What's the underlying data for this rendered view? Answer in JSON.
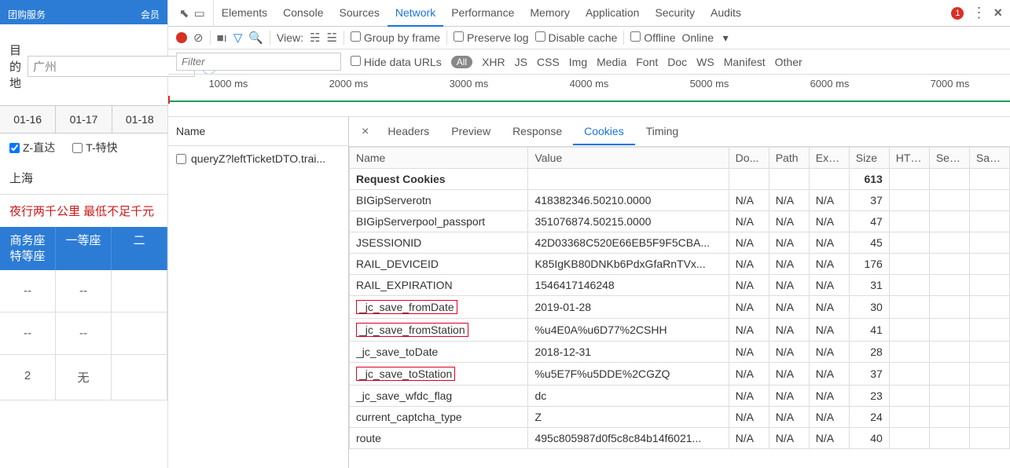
{
  "left": {
    "header": {
      "title": "团购服务",
      "member": "会员"
    },
    "dest_label": "目的地",
    "dest_value": "广州",
    "dates": [
      "01-16",
      "01-17",
      "01-18"
    ],
    "train_types": [
      "Z-直达",
      "T-特快"
    ],
    "city": "上海",
    "redline": "夜行两千公里 最低不足千元",
    "seat_head": [
      [
        "商务座",
        "特等座"
      ],
      [
        "一等座"
      ],
      [
        "二"
      ]
    ],
    "seat_rows": [
      [
        "--",
        "--",
        ""
      ],
      [
        "--",
        "--",
        ""
      ],
      [
        "2",
        "无",
        ""
      ]
    ]
  },
  "devtools": {
    "tabs": [
      "Elements",
      "Console",
      "Sources",
      "Network",
      "Performance",
      "Memory",
      "Application",
      "Security",
      "Audits"
    ],
    "active_tab": "Network",
    "error_count": "1",
    "toolbar": {
      "view_label": "View:",
      "group_label": "Group by frame",
      "preserve": "Preserve log",
      "disable_cache": "Disable cache",
      "offline": "Offline",
      "online": "Online"
    },
    "filter": {
      "placeholder": "Filter",
      "hide_urls": "Hide data URLs",
      "all_pill": "All",
      "types": [
        "XHR",
        "JS",
        "CSS",
        "Img",
        "Media",
        "Font",
        "Doc",
        "WS",
        "Manifest",
        "Other"
      ]
    },
    "timeline": [
      "1000 ms",
      "2000 ms",
      "3000 ms",
      "4000 ms",
      "5000 ms",
      "6000 ms",
      "7000 ms"
    ],
    "req_list": {
      "head": "Name",
      "items": [
        "queryZ?leftTicketDTO.trai..."
      ]
    },
    "detail_tabs": [
      "Headers",
      "Preview",
      "Response",
      "Cookies",
      "Timing"
    ],
    "detail_active": "Cookies",
    "cookie_cols": [
      "Name",
      "Value",
      "Do...",
      "Path",
      "Expi...",
      "Size",
      "HTTP",
      "Sec...",
      "Sam..."
    ],
    "cookie_section": "Request Cookies",
    "cookie_total_size": "613",
    "cookies": [
      {
        "name": "BIGipServerotn",
        "value": "418382346.50210.0000",
        "dom": "N/A",
        "path": "N/A",
        "exp": "N/A",
        "size": "37",
        "box": false
      },
      {
        "name": "BIGipServerpool_passport",
        "value": "351076874.50215.0000",
        "dom": "N/A",
        "path": "N/A",
        "exp": "N/A",
        "size": "47",
        "box": false
      },
      {
        "name": "JSESSIONID",
        "value": "42D03368C520E66EB5F9F5CBA...",
        "dom": "N/A",
        "path": "N/A",
        "exp": "N/A",
        "size": "45",
        "box": false
      },
      {
        "name": "RAIL_DEVICEID",
        "value": "K85IgKB80DNKb6PdxGfaRnTVx...",
        "dom": "N/A",
        "path": "N/A",
        "exp": "N/A",
        "size": "176",
        "box": false
      },
      {
        "name": "RAIL_EXPIRATION",
        "value": "1546417146248",
        "dom": "N/A",
        "path": "N/A",
        "exp": "N/A",
        "size": "31",
        "box": false
      },
      {
        "name": "_jc_save_fromDate",
        "value": "2019-01-28",
        "dom": "N/A",
        "path": "N/A",
        "exp": "N/A",
        "size": "30",
        "box": true
      },
      {
        "name": "_jc_save_fromStation",
        "value": "%u4E0A%u6D77%2CSHH",
        "dom": "N/A",
        "path": "N/A",
        "exp": "N/A",
        "size": "41",
        "box": true
      },
      {
        "name": "_jc_save_toDate",
        "value": "2018-12-31",
        "dom": "N/A",
        "path": "N/A",
        "exp": "N/A",
        "size": "28",
        "box": false
      },
      {
        "name": "_jc_save_toStation",
        "value": "%u5E7F%u5DDE%2CGZQ",
        "dom": "N/A",
        "path": "N/A",
        "exp": "N/A",
        "size": "37",
        "box": true
      },
      {
        "name": "_jc_save_wfdc_flag",
        "value": "dc",
        "dom": "N/A",
        "path": "N/A",
        "exp": "N/A",
        "size": "23",
        "box": false
      },
      {
        "name": "current_captcha_type",
        "value": "Z",
        "dom": "N/A",
        "path": "N/A",
        "exp": "N/A",
        "size": "24",
        "box": false
      },
      {
        "name": "route",
        "value": "495c805987d0f5c8c84b14f6021...",
        "dom": "N/A",
        "path": "N/A",
        "exp": "N/A",
        "size": "40",
        "box": false
      }
    ]
  }
}
